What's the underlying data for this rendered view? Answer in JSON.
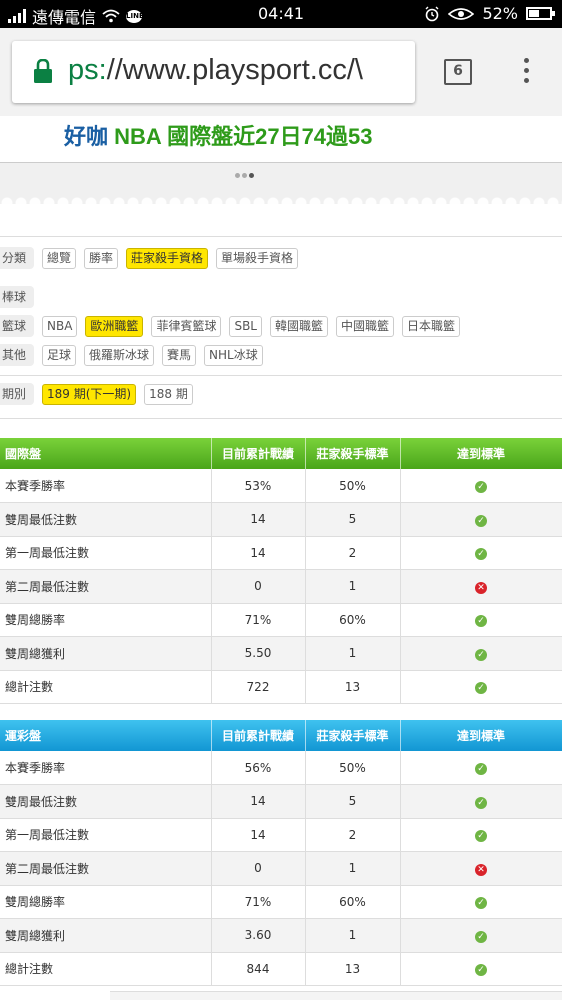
{
  "status_bar": {
    "carrier": "遠傳電信",
    "line_badge": "LINE",
    "time": "04:41",
    "battery": "52%",
    "battery_level": 0.52
  },
  "browser": {
    "url_scheme": "ps:",
    "url_rest": "//www.playsport.cc/\\",
    "tab_count": "6"
  },
  "headline": {
    "part1": "好咖",
    "part2": "NBA 國際盤近27日74過53"
  },
  "filters": {
    "row1": {
      "label": "分類",
      "chips": [
        "總覽",
        "勝率",
        "莊家殺手資格",
        "單場殺手資格"
      ],
      "selected": 2
    },
    "row2": {
      "label": "棒球",
      "chips": []
    },
    "row3": {
      "label": "籃球",
      "chips": [
        "NBA",
        "歐洲職籃",
        "菲律賓籃球",
        "SBL",
        "韓國職籃",
        "中國職籃",
        "日本職籃"
      ],
      "selected": 1
    },
    "row4": {
      "label": "其他",
      "chips": [
        "足球",
        "俄羅斯冰球",
        "賽馬",
        "NHL冰球"
      ]
    },
    "row5": {
      "label": "期別",
      "chips": [
        "189 期(下一期)",
        "188 期"
      ],
      "selected": 0
    }
  },
  "table_intl": {
    "headers": [
      "國際盤",
      "目前累計戰績",
      "莊家殺手標準",
      "達到標準"
    ],
    "rows": [
      {
        "name": "本賽季勝率",
        "current": "53%",
        "standard": "50%",
        "met": true
      },
      {
        "name": "雙周最低注數",
        "current": "14",
        "standard": "5",
        "met": true
      },
      {
        "name": "第一周最低注數",
        "current": "14",
        "standard": "2",
        "met": true
      },
      {
        "name": "第二周最低注數",
        "current": "0",
        "standard": "1",
        "met": false
      },
      {
        "name": "雙周總勝率",
        "current": "71%",
        "standard": "60%",
        "met": true
      },
      {
        "name": "雙周總獲利",
        "current": "5.50",
        "standard": "1",
        "met": true
      },
      {
        "name": "總計注數",
        "current": "722",
        "standard": "13",
        "met": true
      }
    ]
  },
  "table_lottery": {
    "headers": [
      "運彩盤",
      "目前累計戰績",
      "莊家殺手標準",
      "達到標準"
    ],
    "rows": [
      {
        "name": "本賽季勝率",
        "current": "56%",
        "standard": "50%",
        "met": true
      },
      {
        "name": "雙周最低注數",
        "current": "14",
        "standard": "5",
        "met": true
      },
      {
        "name": "第一周最低注數",
        "current": "14",
        "standard": "2",
        "met": true
      },
      {
        "name": "第二周最低注數",
        "current": "0",
        "standard": "1",
        "met": false
      },
      {
        "name": "雙周總勝率",
        "current": "71%",
        "standard": "60%",
        "met": true
      },
      {
        "name": "雙周總獲利",
        "current": "3.60",
        "standard": "1",
        "met": true
      },
      {
        "name": "總計注數",
        "current": "844",
        "standard": "13",
        "met": true
      }
    ]
  },
  "colors": {
    "green_header": "#4aa51a",
    "blue_header": "#1296d3",
    "selected_chip": "#ffe600",
    "ok": "#6fb544",
    "fail": "#d9232a"
  }
}
